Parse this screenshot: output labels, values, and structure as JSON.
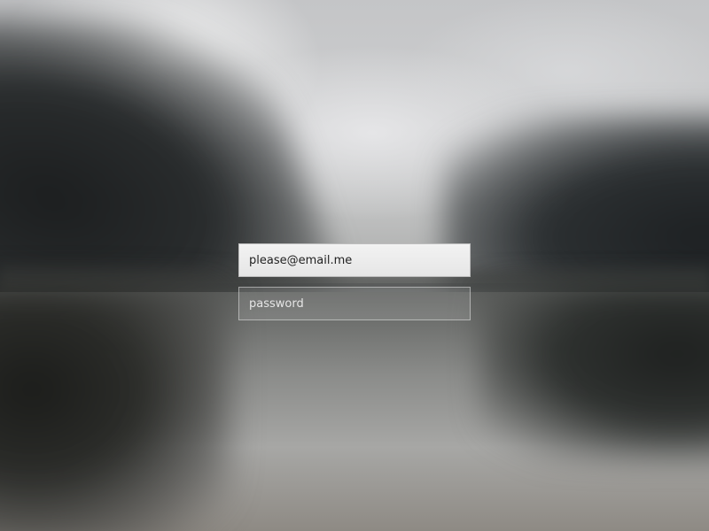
{
  "login_form": {
    "email_value": "please@email.me",
    "password_placeholder": "password"
  }
}
